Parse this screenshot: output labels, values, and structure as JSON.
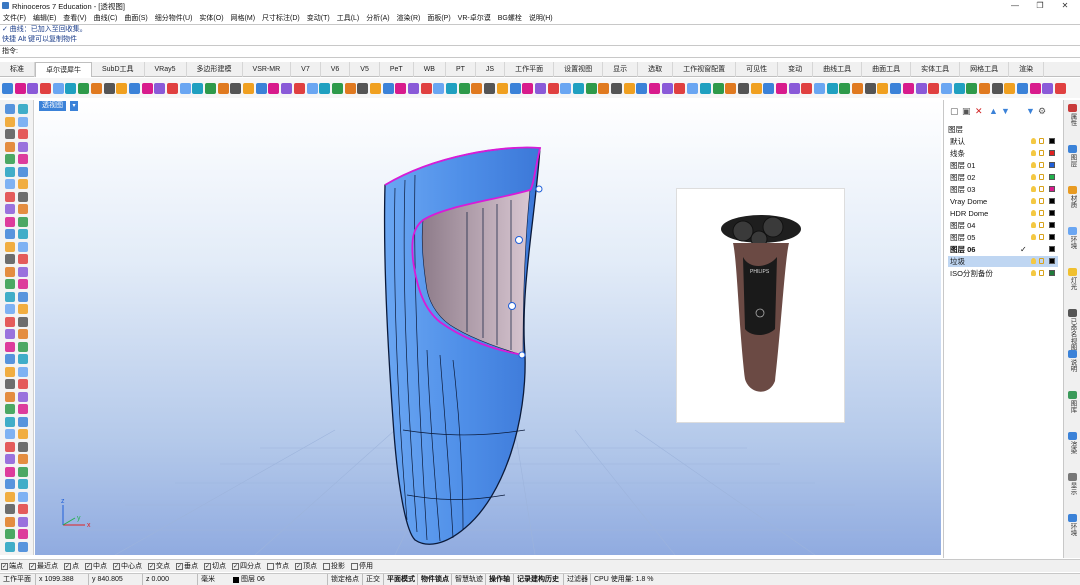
{
  "title_bar": {
    "title": "Rhinoceros 7 Education - [透视图]",
    "minimize": "—",
    "maximize": "❐",
    "close": "✕"
  },
  "menu": [
    "文件(F)",
    "编辑(E)",
    "查看(V)",
    "曲线(C)",
    "曲面(S)",
    "细分物件(U)",
    "实体(O)",
    "网格(M)",
    "尺寸标注(D)",
    "变动(T)",
    "工具(L)",
    "分析(A)",
    "渲染(R)",
    "面板(P)",
    "VR-卓尔谟",
    "BG螺栓",
    "说明(H)"
  ],
  "command_history": [
    "✓ 曲线：已加入至回收集。",
    "快捷 Alt 键可以复制物件"
  ],
  "command_prompt": "指令:",
  "tabs": [
    "标准",
    "卓尔谟犀牛",
    "SubD工具",
    "VRay5",
    "多边形建模",
    "VSR-MR",
    "V7",
    "V6",
    "V5",
    "PeT",
    "WB",
    "PT",
    "JS",
    "工作平面",
    "设置视图",
    "显示",
    "选取",
    "工作视窗配置",
    "可见性",
    "变动",
    "曲线工具",
    "曲面工具",
    "实体工具",
    "网格工具",
    "渲染"
  ],
  "active_tab": "卓尔谟犀牛",
  "viewport": {
    "label": "透视图",
    "dropdown": "▾",
    "axis_x": "x",
    "axis_y": "y",
    "axis_z": "z"
  },
  "layers_panel": {
    "header": "图层",
    "layers": [
      {
        "name": "默认",
        "color": "#000000",
        "current": false,
        "selected": false
      },
      {
        "name": "线条",
        "color": "#e02020",
        "current": false,
        "selected": false
      },
      {
        "name": "图层 01",
        "color": "#1f5fd8",
        "current": false,
        "selected": false
      },
      {
        "name": "图层 02",
        "color": "#22b14c",
        "current": false,
        "selected": false
      },
      {
        "name": "图层 03",
        "color": "#d81b8c",
        "current": false,
        "selected": false
      },
      {
        "name": "Vray Dome",
        "color": "#000000",
        "current": false,
        "selected": false
      },
      {
        "name": "HDR Dome",
        "color": "#000000",
        "current": false,
        "selected": false
      },
      {
        "name": "图层 04",
        "color": "#000000",
        "current": false,
        "selected": false
      },
      {
        "name": "图层 05",
        "color": "#000000",
        "current": false,
        "selected": false
      },
      {
        "name": "图层 06",
        "color": "#000000",
        "current": true,
        "selected": false
      },
      {
        "name": "垃圾",
        "color": "#000000",
        "current": false,
        "selected": true
      },
      {
        "name": "ISO分割备份",
        "color": "#1f7a3a",
        "current": false,
        "selected": false
      }
    ],
    "current_mark": "✓"
  },
  "right_tabs": [
    {
      "label": "属性",
      "icon": "properties-icon"
    },
    {
      "label": "图层",
      "icon": "layers-icon"
    },
    {
      "label": "材质",
      "icon": "material-icon"
    },
    {
      "label": "环境",
      "icon": "environment-icon"
    },
    {
      "label": "灯光",
      "icon": "light-icon"
    },
    {
      "label": "已命名视图",
      "icon": "named-views-icon"
    },
    {
      "label": "说明",
      "icon": "help-icon"
    },
    {
      "label": "图库",
      "icon": "library-icon"
    },
    {
      "label": "渲染",
      "icon": "render-icon"
    },
    {
      "label": "显示",
      "icon": "display-icon"
    },
    {
      "label": "环境",
      "icon": "environment-icon"
    }
  ],
  "osnaps": [
    {
      "label": "端点",
      "checked": true
    },
    {
      "label": "最近点",
      "checked": true
    },
    {
      "label": "点",
      "checked": true
    },
    {
      "label": "中点",
      "checked": true
    },
    {
      "label": "中心点",
      "checked": true
    },
    {
      "label": "交点",
      "checked": true
    },
    {
      "label": "垂点",
      "checked": true
    },
    {
      "label": "切点",
      "checked": true
    },
    {
      "label": "四分点",
      "checked": true
    },
    {
      "label": "节点",
      "checked": false
    },
    {
      "label": "顶点",
      "checked": true
    },
    {
      "label": "投影",
      "checked": false
    },
    {
      "label": "停用",
      "checked": false
    }
  ],
  "status": {
    "cplane": "工作平面",
    "x": "x 1099.388",
    "y": "y 840.805",
    "z": "z 0.000",
    "unit": "毫米",
    "layer": "图层 06",
    "lock_grid": "锁定格点",
    "ortho": "正交",
    "planar": "平面模式",
    "osnap": "物件锁点",
    "smarttrack": "智慧轨迹",
    "gumball": "操作轴",
    "history": "记录建构历史",
    "filter": "过滤器",
    "cpu": "CPU 使用量: 1.8 %"
  },
  "photo": {
    "brand": "PHILIPS"
  },
  "colors": {
    "accent": "#3b82d8",
    "surface_blue": "#4f8fe8",
    "magenta": "#d81bd8"
  }
}
